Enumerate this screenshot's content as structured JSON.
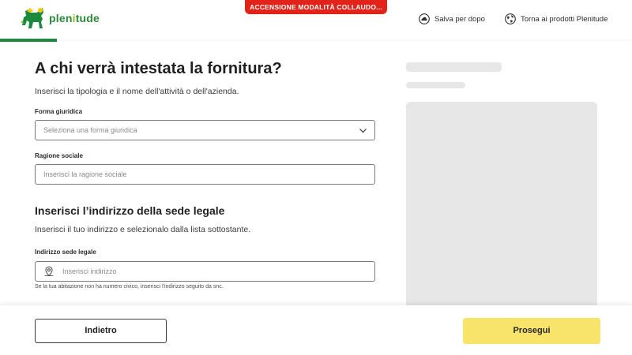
{
  "header": {
    "brand_prefix": "plen",
    "brand_accent": "i",
    "brand_suffix": "tude",
    "banner_text": "ACCENSIONE MODALITÀ COLLAUDO...",
    "save_label": "Salva per dopo",
    "save_icon": "cloud-icon",
    "back_label": "Torna ai prodotti Plenitude",
    "back_icon": "globe-icon",
    "progress_color": "#1b8a3e"
  },
  "main": {
    "title": "A chi verrà intestata la fornitura?",
    "subtitle": "Inserisci la tipologia e il nome dell'attività o dell'azienda.",
    "legal_form": {
      "label": "Forma giuridica",
      "placeholder": "Seleziona una forma giuridica"
    },
    "company_name": {
      "label": "Ragione sociale",
      "placeholder": "Inserisci la ragione sociale"
    },
    "address_section": {
      "title": "Inserisci l’indirizzo della sede legale",
      "subtitle": "Inserisci il tuo indirizzo e selezionalo dalla lista sottostante."
    },
    "address": {
      "label": "Indirizzo sede legale",
      "placeholder": "Inserisci indirizzo",
      "hint": "Se la tua abitazione non ha numero civico, inserisci l'indirizzo seguito da snc."
    }
  },
  "footer": {
    "back_label": "Indietro",
    "next_label": "Prosegui",
    "next_color": "#f8e36b"
  }
}
